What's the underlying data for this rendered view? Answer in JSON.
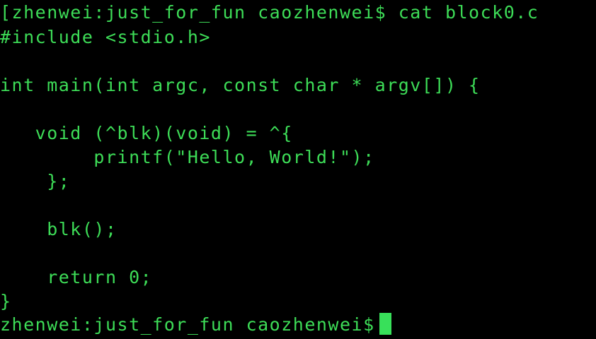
{
  "terminal": {
    "colors": {
      "background": "#000000",
      "text": "#3ddc57",
      "cursor": "#38e05a"
    },
    "lines": [
      "[zhenwei:just_for_fun caozhenwei$ cat block0.c",
      "#include <stdio.h>",
      "",
      "int main(int argc, const char * argv[]) {",
      "",
      "   void (^blk)(void) = ^{",
      "        printf(\"Hello, World!\");",
      "    };",
      "",
      "    blk();",
      "",
      "    return 0;",
      "}"
    ],
    "prompt": "zhenwei:just_for_fun caozhenwei$"
  }
}
